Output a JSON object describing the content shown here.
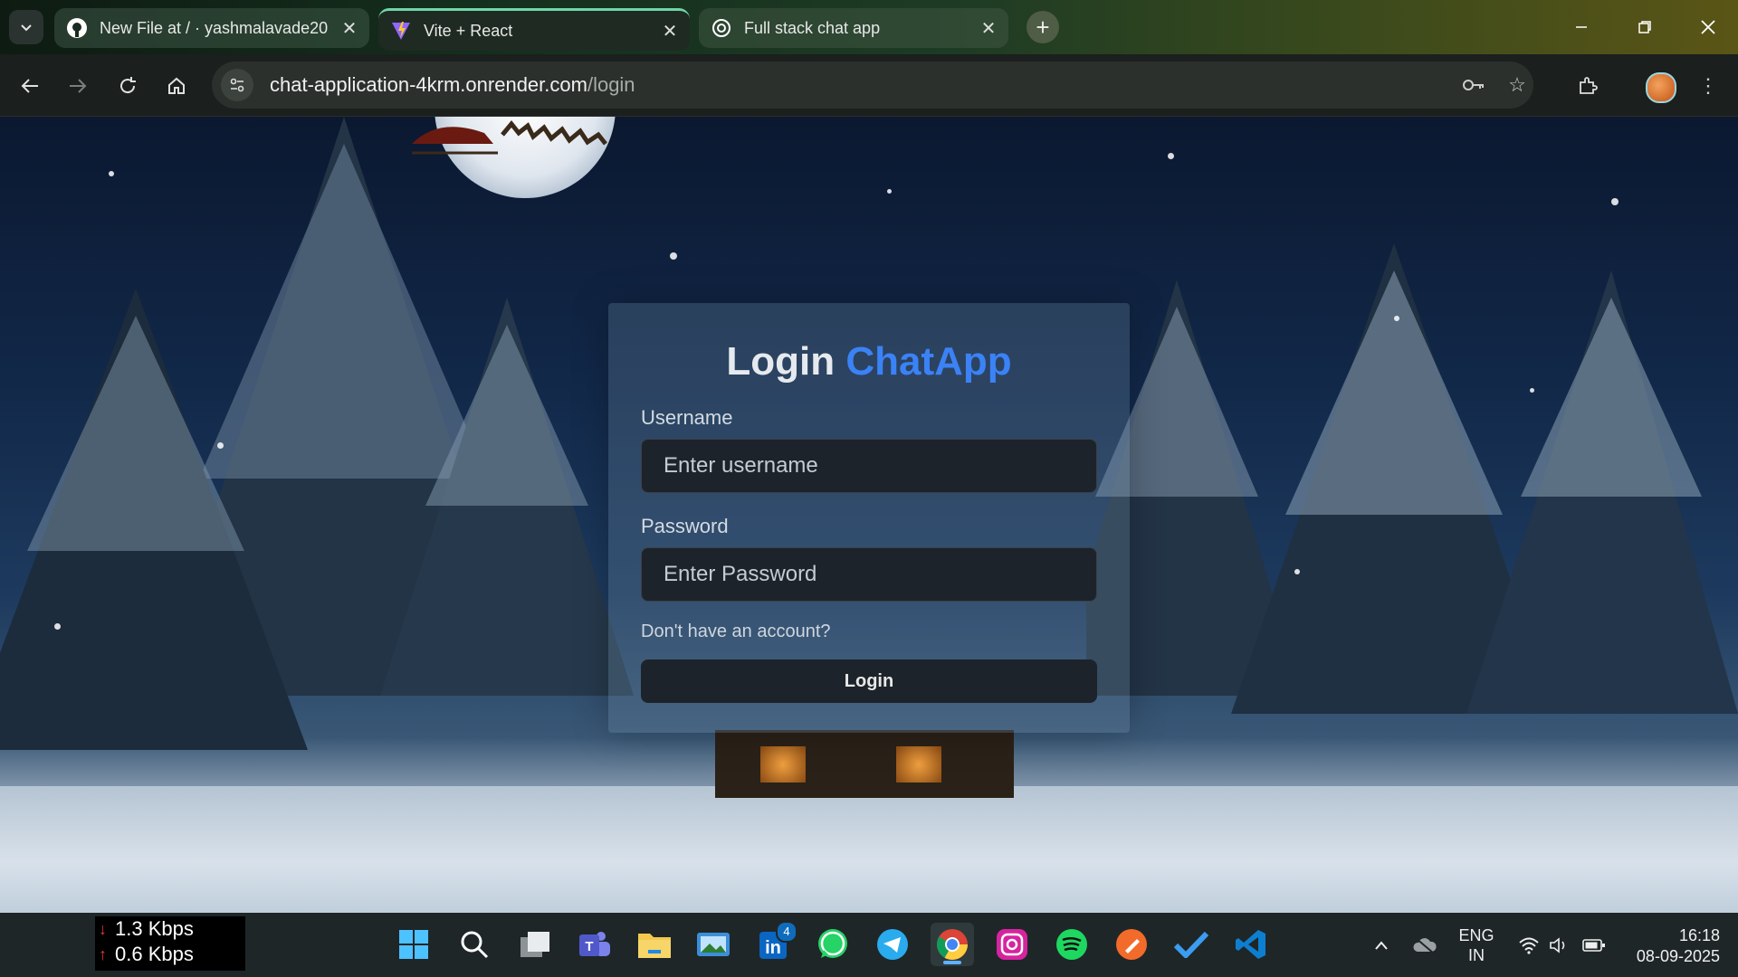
{
  "tabs": [
    {
      "title": "New File at / · yashmalavade20",
      "icon": "github-icon",
      "active": false
    },
    {
      "title": "Vite + React",
      "icon": "vite-icon",
      "active": true
    },
    {
      "title": "Full stack chat app",
      "icon": "openai-icon",
      "active": false
    }
  ],
  "address_bar": {
    "domain": "chat-application-4krm.onrender.com",
    "path": "/login"
  },
  "login": {
    "title": "Login",
    "brand": "ChatApp",
    "username_label": "Username",
    "username_placeholder": "Enter username",
    "password_label": "Password",
    "password_placeholder": "Enter Password",
    "signup_link": "Don't have an account?",
    "login_button": "Login",
    "accent_color": "#3b82f6"
  },
  "taskbar": {
    "net_down": "1.3 Kbps",
    "net_up": "0.6 Kbps",
    "apps": [
      "start-icon",
      "search-icon",
      "task-view-icon",
      "teams-icon",
      "file-explorer-icon",
      "photos-icon",
      "linkedin-icon",
      "whatsapp-icon",
      "telegram-icon",
      "chrome-icon",
      "instagram-icon",
      "spotify-icon",
      "sketch-icon",
      "todo-icon",
      "vscode-icon"
    ],
    "linkedin_badge": "4",
    "lang_line1": "ENG",
    "lang_line2": "IN",
    "time": "16:18",
    "date": "08-09-2025"
  }
}
